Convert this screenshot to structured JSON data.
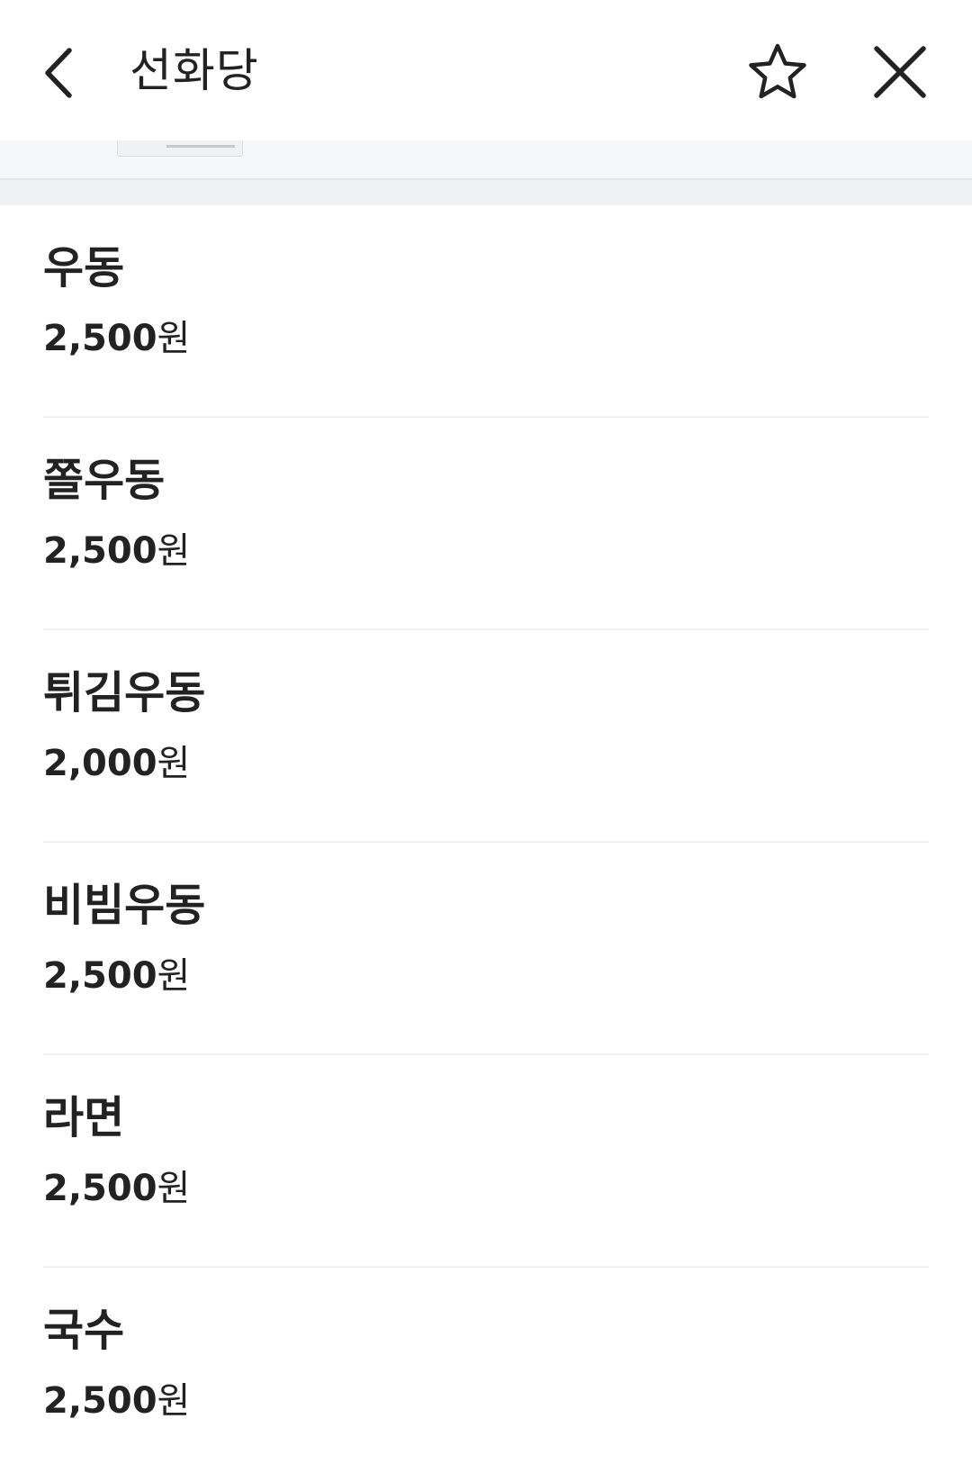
{
  "header": {
    "title": "선화당",
    "back_icon": "chevron-left-icon",
    "favorite_icon": "star-outline-icon",
    "close_icon": "close-icon"
  },
  "menu": {
    "currency_unit": "원",
    "items": [
      {
        "name": "우동",
        "price": "2,500"
      },
      {
        "name": "쫄우동",
        "price": "2,500"
      },
      {
        "name": "튀김우동",
        "price": "2,000"
      },
      {
        "name": "비빔우동",
        "price": "2,500"
      },
      {
        "name": "라면",
        "price": "2,500"
      },
      {
        "name": "국수",
        "price": "2,500"
      }
    ]
  },
  "colors": {
    "text": "#222222",
    "divider": "#efefef",
    "band": "#eff0f2",
    "background": "#ffffff"
  }
}
